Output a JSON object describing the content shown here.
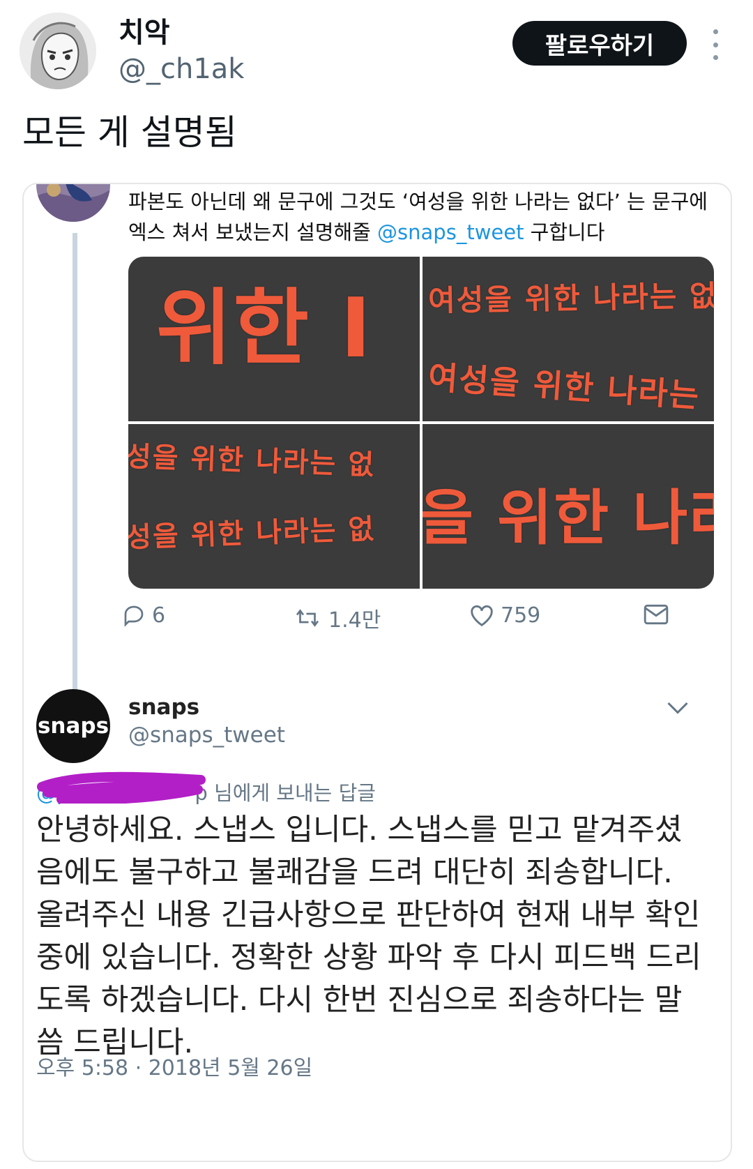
{
  "author": {
    "name": "치악",
    "handle": "@_ch1ak",
    "follow_label": "팔로우하기"
  },
  "tweet": {
    "text": "모든 게 설명됨"
  },
  "embedded": {
    "original_post": {
      "text_before": "파본도 아닌데 왜 문구에 그것도 ‘여성을 위한 나라는 없다’ 는 문구에 엑스 쳐서 보냈는지 설명해줄 ",
      "mention": "@snaps_tweet",
      "text_after": " 구합니다",
      "images": [
        [
          "위한 I"
        ],
        [
          "여성을 위한 나라는 없",
          "여성을 위한 나라는"
        ],
        [
          "성을 위한 나라는 없",
          "성을 위한 나라는 없"
        ],
        [
          "을 위한 나라"
        ]
      ],
      "actions": {
        "reply_count": "6",
        "retweet_count": "1.4만",
        "like_count": "759"
      }
    },
    "reply": {
      "brand_logo_text": "snaps",
      "name": "snaps",
      "handle": "@snaps_tweet",
      "reply_to_prefix": "@p",
      "reply_to_suffix": "p 님에게 보내는 답글",
      "body": "안녕하세요. 스냅스 입니다. 스냅스를 믿고 맡겨주셨음에도 불구하고 불쾌감을 드려 대단히 죄송합니다. 올려주신 내용 긴급사항으로 판단하여 현재 내부 확인 중에 있습니다. 정확한 상황 파악 후 다시 피드백 드리도록 하겠습니다. 다시 한번 진심으로 죄송하다는 말씀 드립니다.",
      "timestamp": "오후 5:58 · 2018년 5월 26일"
    }
  },
  "colors": {
    "link": "#1b95e0",
    "banner_bg": "#3b3b3b",
    "banner_text": "#ef5a3b",
    "follow_bg": "#0f1419"
  },
  "icons": [
    "more-vertical-icon",
    "reply-icon",
    "retweet-icon",
    "like-icon",
    "dm-icon",
    "chevron-down-icon"
  ]
}
